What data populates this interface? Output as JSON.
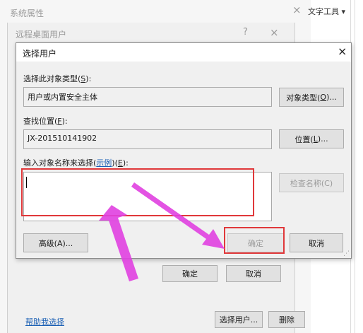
{
  "system_window": {
    "title": "系统属性",
    "close_icon": "×",
    "tool_menu": "文字工具 ▾"
  },
  "rdp_window": {
    "title": "远程桌面用户",
    "help_icon": "?",
    "close_icon": "×",
    "ok": "确定",
    "cancel": "取消",
    "help_link": "帮助我选择",
    "select_users": "选择用户...",
    "remove": "删除"
  },
  "dialog": {
    "title": "选择用户",
    "close_icon": "×",
    "object_type_label": "选择此对象类型(",
    "object_type_key": "S",
    "object_type_label_end": "):",
    "object_type_value": "用户或内置安全主体",
    "object_type_button": "对象类型(",
    "object_type_button_key": "O",
    "object_type_button_end": ")...",
    "location_label": "查找位置(",
    "location_key": "F",
    "location_label_end": "):",
    "location_value": "JX-201510141902",
    "location_button": "位置(",
    "location_button_key": "L",
    "location_button_end": ")...",
    "names_label": "输入对象名称来选择(",
    "names_link": "示例",
    "names_label_mid": ")(",
    "names_key": "E",
    "names_label_end": "):",
    "names_value": "",
    "check_names_button": "检查名称(C)",
    "advanced_button": "高级(A)...",
    "ok_button": "确定",
    "cancel_button": "取消"
  },
  "colors": {
    "annotation_red": "#e0383a",
    "annotation_arrow": "#e040e0",
    "link_blue": "#1a5fb4"
  }
}
